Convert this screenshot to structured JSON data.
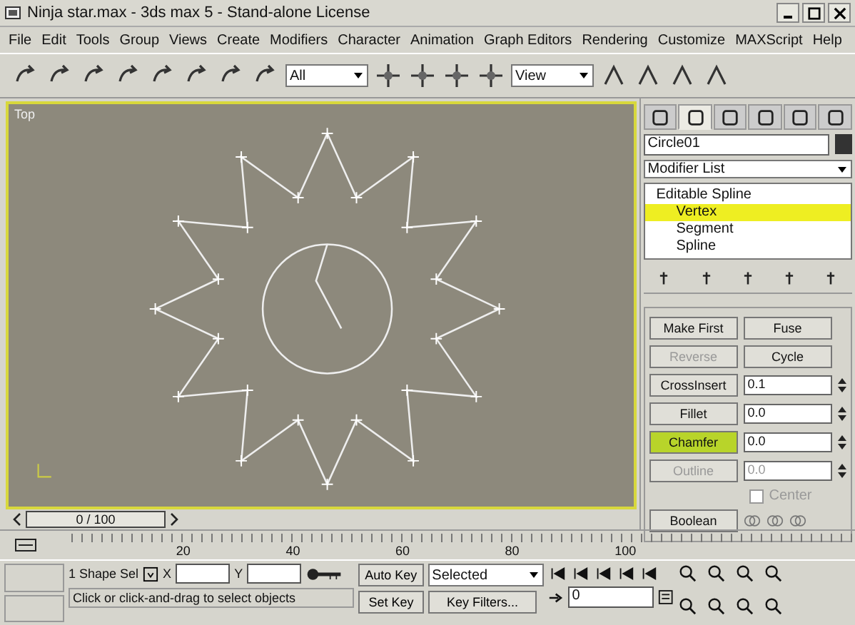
{
  "window": {
    "title": "Ninja star.max - 3ds max 5 - Stand-alone License"
  },
  "menu": [
    "File",
    "Edit",
    "Tools",
    "Group",
    "Views",
    "Create",
    "Modifiers",
    "Character",
    "Animation",
    "Graph Editors",
    "Rendering",
    "Customize",
    "MAXScript",
    "Help"
  ],
  "toolbar": {
    "selection_filter": "All",
    "reference_coord": "View"
  },
  "viewport": {
    "label": "Top",
    "time_slider": "0 / 100"
  },
  "command_panel": {
    "tabs": [
      {
        "selected": false
      },
      {
        "selected": true
      },
      {
        "selected": false
      },
      {
        "selected": false
      },
      {
        "selected": false
      },
      {
        "selected": false
      }
    ],
    "object_name": "Circle01",
    "modifier_list": "Modifier List",
    "stack": [
      {
        "label": "Editable Spline",
        "selected": false,
        "children": [
          {
            "label": "Vertex",
            "selected": true
          },
          {
            "label": "Segment",
            "selected": false
          },
          {
            "label": "Spline",
            "selected": false
          }
        ]
      }
    ],
    "geometry": [
      {
        "kind": "pair",
        "buttons": [
          {
            "label": "Make First",
            "disabled": false
          },
          {
            "label": "Fuse",
            "disabled": false
          }
        ]
      },
      {
        "kind": "pair",
        "buttons": [
          {
            "label": "Reverse",
            "disabled": true
          },
          {
            "label": "Cycle",
            "disabled": false
          }
        ]
      },
      {
        "kind": "spinner",
        "label": "CrossInsert",
        "value": "0.1",
        "active": false,
        "disabled": false
      },
      {
        "kind": "spinner",
        "label": "Fillet",
        "value": "0.0",
        "active": false,
        "disabled": false
      },
      {
        "kind": "spinner",
        "label": "Chamfer",
        "value": "0.0",
        "active": true,
        "disabled": false
      },
      {
        "kind": "spinner",
        "label": "Outline",
        "value": "0.0",
        "active": false,
        "disabled": true
      },
      {
        "kind": "checkbox",
        "label": "Center",
        "checked": false,
        "disabled": true
      },
      {
        "kind": "boolean",
        "label": "Boolean"
      }
    ]
  },
  "timeline": {
    "ticks": [
      "20",
      "40",
      "60",
      "80",
      "100"
    ]
  },
  "status_bar": {
    "selection": "1 Shape Sel",
    "x_label": "X",
    "y_label": "Y",
    "auto_key": "Auto Key",
    "key_mode": "Selected",
    "set_key": "Set Key",
    "key_filters": "Key Filters...",
    "frame": "0",
    "prompt": "Click or click-and-drag to select objects"
  }
}
